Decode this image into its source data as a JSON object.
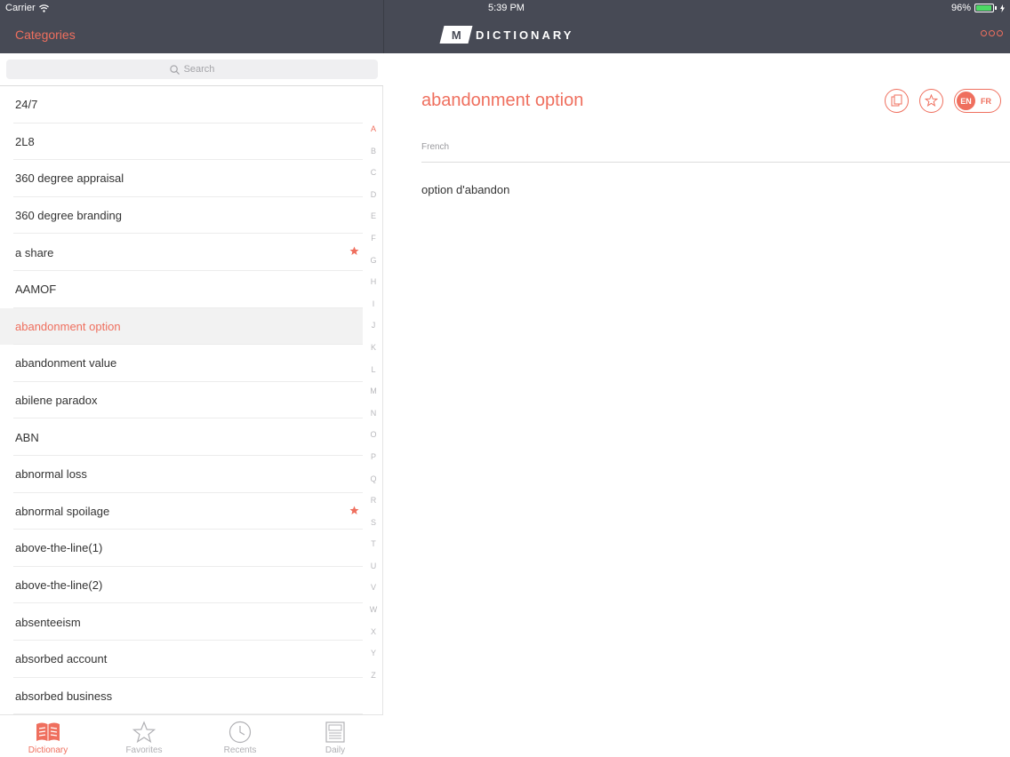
{
  "status_bar": {
    "carrier": "Carrier",
    "time": "5:39 PM",
    "battery": "96%",
    "battery_level": 0.96
  },
  "nav": {
    "categories_label": "Categories",
    "logo_letter": "M",
    "brand": "DICTIONARY",
    "more_icon": "more-dots-icon"
  },
  "search": {
    "placeholder": "Search"
  },
  "terms": [
    {
      "label": "24/7",
      "favorite": false,
      "selected": false
    },
    {
      "label": "2L8",
      "favorite": false,
      "selected": false
    },
    {
      "label": "360 degree appraisal",
      "favorite": false,
      "selected": false
    },
    {
      "label": "360 degree branding",
      "favorite": false,
      "selected": false
    },
    {
      "label": "a share",
      "favorite": true,
      "selected": false
    },
    {
      "label": "AAMOF",
      "favorite": false,
      "selected": false
    },
    {
      "label": "abandonment option",
      "favorite": false,
      "selected": true
    },
    {
      "label": "abandonment value",
      "favorite": false,
      "selected": false
    },
    {
      "label": "abilene paradox",
      "favorite": false,
      "selected": false
    },
    {
      "label": "ABN",
      "favorite": false,
      "selected": false
    },
    {
      "label": "abnormal loss",
      "favorite": false,
      "selected": false
    },
    {
      "label": "abnormal spoilage",
      "favorite": true,
      "selected": false
    },
    {
      "label": "above-the-line(1)",
      "favorite": false,
      "selected": false
    },
    {
      "label": "above-the-line(2)",
      "favorite": false,
      "selected": false
    },
    {
      "label": "absenteeism",
      "favorite": false,
      "selected": false
    },
    {
      "label": "absorbed account",
      "favorite": false,
      "selected": false
    },
    {
      "label": "absorbed business",
      "favorite": false,
      "selected": false
    }
  ],
  "index_letters": [
    "A",
    "B",
    "C",
    "D",
    "E",
    "F",
    "G",
    "H",
    "I",
    "J",
    "K",
    "L",
    "M",
    "N",
    "O",
    "P",
    "Q",
    "R",
    "S",
    "T",
    "U",
    "V",
    "W",
    "X",
    "Y",
    "Z"
  ],
  "index_active": "A",
  "tabs": [
    {
      "label": "Dictionary",
      "icon": "book-icon",
      "active": true
    },
    {
      "label": "Favorites",
      "icon": "star-icon",
      "active": false
    },
    {
      "label": "Recents",
      "icon": "clock-icon",
      "active": false
    },
    {
      "label": "Daily",
      "icon": "newspaper-icon",
      "active": false
    }
  ],
  "detail": {
    "term": "abandonment option",
    "section": "French",
    "translation": "option d'abandon",
    "lang_en": "EN",
    "lang_fr": "FR",
    "copy_icon": "copy-icon",
    "favorite_icon": "star-icon"
  },
  "colors": {
    "accent": "#ef6f5e",
    "navbar": "#474a55",
    "muted": "#b0b0b4"
  }
}
